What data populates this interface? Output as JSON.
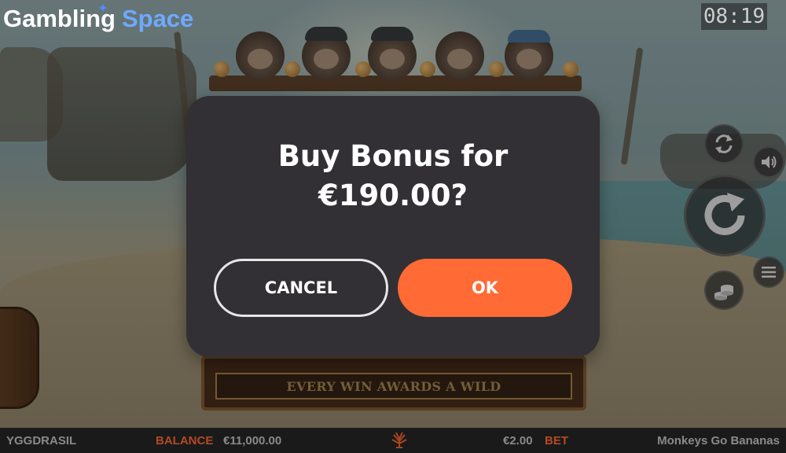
{
  "header": {
    "logo_word1": "Gambling",
    "logo_word2": "Space",
    "clock": "08:19"
  },
  "game": {
    "banner_text": "EVERY WIN AWARDS A WILD"
  },
  "modal": {
    "title_line1": "Buy Bonus for",
    "title_line2": "€190.00?",
    "cancel_label": "CANCEL",
    "ok_label": "OK"
  },
  "controls": {
    "autoplay_icon": "autoplay-icon",
    "sound_icon": "speaker-icon",
    "spin_icon": "spin-icon",
    "menu_icon": "hamburger-menu-icon",
    "bet_icon": "coin-stack-icon"
  },
  "footer": {
    "provider": "YGGDRASIL",
    "balance_label": "BALANCE",
    "balance_value": "€11,000.00",
    "bet_value": "€2.00",
    "bet_label": "BET",
    "game_title": "Monkeys Go Bananas"
  },
  "colors": {
    "modal_bg": "#323034",
    "ok_button": "#ff6a35",
    "label_accent": "#b44a24",
    "logo_accent": "#6fa9ff"
  }
}
